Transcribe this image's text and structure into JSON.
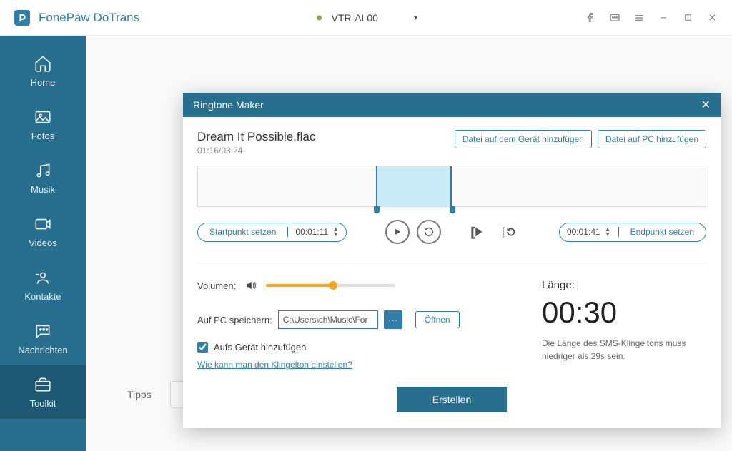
{
  "app": {
    "title": "FonePaw DoTrans",
    "device": "VTR-AL00"
  },
  "sidebar": {
    "items": [
      {
        "label": "Home"
      },
      {
        "label": "Fotos"
      },
      {
        "label": "Musik"
      },
      {
        "label": "Videos"
      },
      {
        "label": "Kontakte"
      },
      {
        "label": "Nachrichten"
      },
      {
        "label": "Toolkit"
      }
    ]
  },
  "tipps": {
    "label": "Tipps"
  },
  "modal": {
    "title": "Ringtone Maker",
    "file_name": "Dream It Possible.flac",
    "file_time": "01:16/03:24",
    "btn_add_device": "Datei auf dem Gerät hinzufügen",
    "btn_add_pc": "Datei auf PC hinzufügen",
    "start_label": "Startpunkt setzen",
    "start_time": "00:01:11",
    "end_label": "Endpunkt setzen",
    "end_time": "00:01:41",
    "volume_label": "Volumen:",
    "save_label": "Auf PC speichern:",
    "save_path": "C:\\Users\\ch\\Music\\For",
    "open_label": "Öffnen",
    "check_label": "Aufs Gerät hinzufügen",
    "help_link": "Wie kann man den Klingelton einstellen?",
    "length_label": "Länge:",
    "length_value": "00:30",
    "length_hint": "Die Länge des SMS-Klingeltons muss niedriger als 29s sein.",
    "create_label": "Erstellen"
  }
}
